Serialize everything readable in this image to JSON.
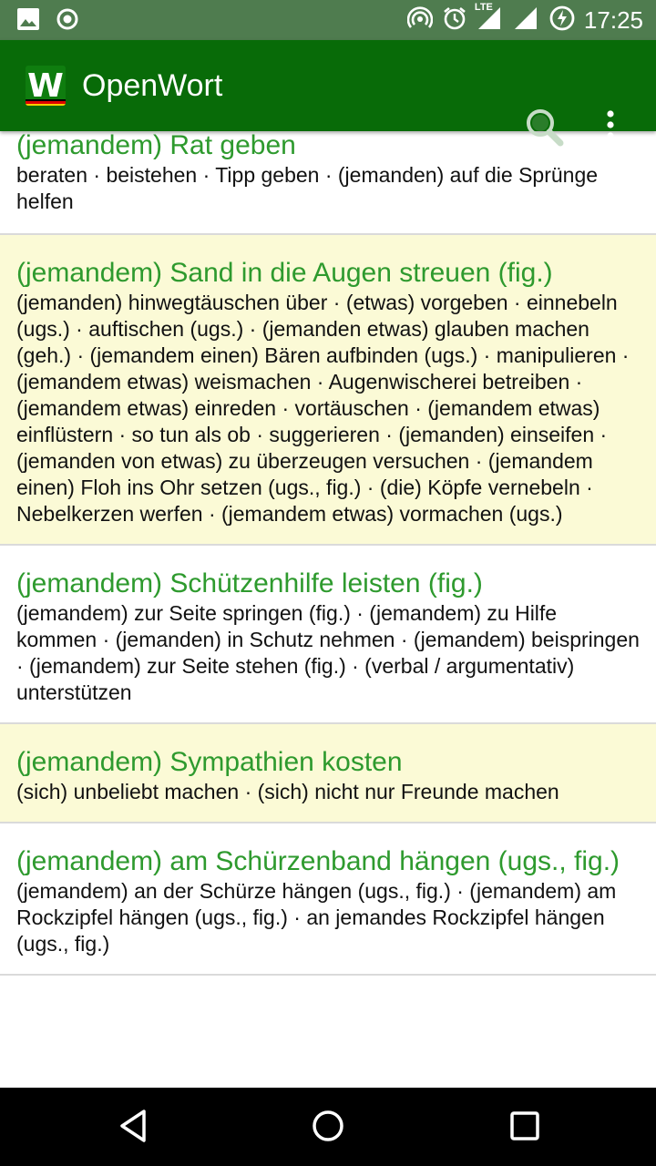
{
  "status_bar": {
    "time": "17:25",
    "network_label": "LTE",
    "icons": [
      "image-icon",
      "record-icon",
      "hotspot-icon",
      "alarm-icon",
      "signal-icon",
      "signal-icon",
      "battery-charging-icon"
    ]
  },
  "app_bar": {
    "title": "OpenWort",
    "logo_letter": "W",
    "actions": [
      "search-icon",
      "more-vert-icon"
    ]
  },
  "entries": [
    {
      "headword": "(jemandem) Rat geben",
      "synonyms": "beraten · beistehen · Tipp geben · (jemanden) auf die Sprünge helfen"
    },
    {
      "headword": "(jemandem) Sand in die Augen streuen (fig.)",
      "synonyms": "(jemanden) hinwegtäuschen über · (etwas) vorgeben · einnebeln (ugs.) · auftischen (ugs.) · (jemanden etwas) glauben machen (geh.) · (jemandem einen) Bären aufbinden (ugs.) · manipulieren · (jemandem etwas) weismachen · Augenwischerei betreiben · (jemandem etwas) einreden · vortäuschen · (jemandem etwas) einflüstern · so tun als ob · suggerieren · (jemanden) einseifen · (jemanden von etwas) zu überzeugen versuchen · (jemandem einen) Floh ins Ohr setzen (ugs., fig.) · (die) Köpfe vernebeln · Nebelkerzen werfen · (jemandem etwas) vormachen (ugs.)"
    },
    {
      "headword": "(jemandem) Schützenhilfe leisten (fig.)",
      "synonyms": "(jemandem) zur Seite springen (fig.) · (jemandem) zu Hilfe kommen · (jemanden) in Schutz nehmen · (jemandem) beispringen · (jemandem) zur Seite stehen (fig.) · (verbal / argumentativ) unterstützen"
    },
    {
      "headword": "(jemandem) Sympathien kosten",
      "synonyms": "(sich) unbeliebt machen · (sich) nicht nur Freunde machen"
    },
    {
      "headword": "(jemandem) am Schürzenband hängen (ugs., fig.)",
      "synonyms": "(jemandem) an der Schürze hängen (ugs., fig.) · (jemandem) am Rockzipfel hängen (ugs., fig.) · an jemandes Rockzipfel hängen (ugs., fig.)"
    }
  ],
  "nav_bar": {
    "buttons": [
      "back-icon",
      "home-icon",
      "recents-icon"
    ]
  },
  "colors": {
    "status_bar": "#4f7c4f",
    "app_bar": "#086b08",
    "headword": "#2e9a2e",
    "alt_row": "#fbfad6",
    "divider": "#dadada"
  }
}
